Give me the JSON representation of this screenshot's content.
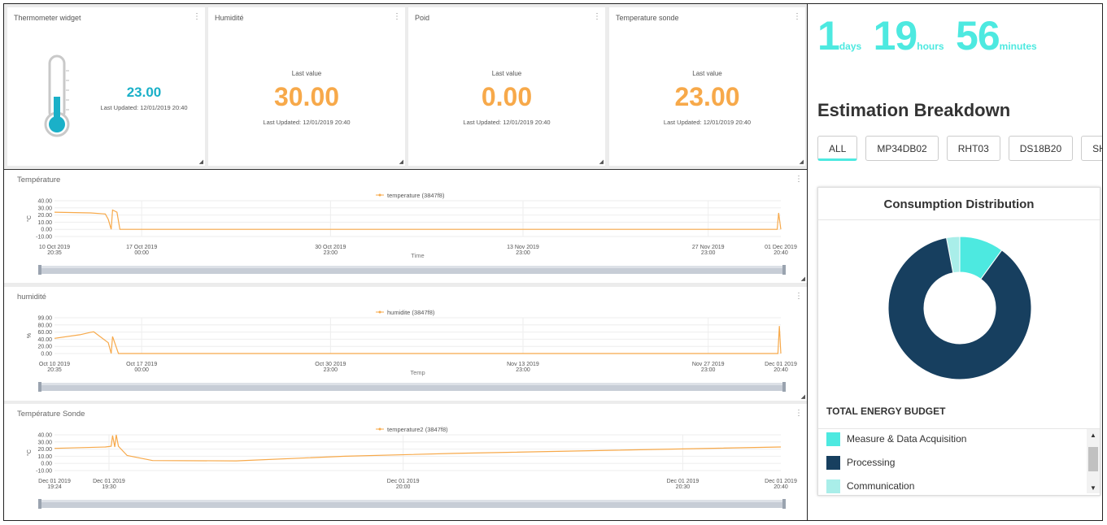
{
  "widgets": {
    "thermometer": {
      "title": "Thermometer widget",
      "value": "23.00",
      "updated": "Last Updated: 12/01/2019 20:40"
    },
    "humidity": {
      "title": "Humidité",
      "last_label": "Last value",
      "value": "30.00",
      "updated": "Last Updated: 12/01/2019 20:40"
    },
    "weight": {
      "title": "Poid",
      "last_label": "Last value",
      "value": "0.00",
      "updated": "Last Updated: 12/01/2019 20:40"
    },
    "probe": {
      "title": "Temperature sonde",
      "last_label": "Last value",
      "value": "23.00",
      "updated": "Last Updated: 12/01/2019 20:40"
    }
  },
  "charts": {
    "temperature": {
      "title": "Température",
      "legend": "temperature  (3847f8)",
      "xlabel": "Time",
      "ylabel": "°C"
    },
    "humidite": {
      "title": "humidité",
      "legend": "humidite  (3847f8)",
      "xlabel": "Temp",
      "ylabel": "%"
    },
    "sonde": {
      "title": "Température Sonde",
      "legend": "temperature2  (3847f8)",
      "xlabel": "",
      "ylabel": "°C"
    }
  },
  "chart_data": [
    {
      "type": "line",
      "title": "Température",
      "xlabel": "Time",
      "ylabel": "°C",
      "ylim": [
        -10,
        40
      ],
      "yticks": [
        "40.00",
        "30.00",
        "20.00",
        "10.00",
        "0.00",
        "-10.00"
      ],
      "xticks": [
        {
          "d": "10 Oct 2019",
          "t": "20:35"
        },
        {
          "d": "17 Oct 2019",
          "t": "00:00"
        },
        {
          "d": "30 Oct 2019",
          "t": "23:00"
        },
        {
          "d": "13 Nov 2019",
          "t": "23:00"
        },
        {
          "d": "27 Nov 2019",
          "t": "23:00"
        },
        {
          "d": "01 Dec 2019",
          "t": "20:40"
        }
      ],
      "series": [
        {
          "name": "temperature  (3847f8)",
          "x": [
            0,
            0.05,
            0.07,
            0.074,
            0.078,
            0.08,
            0.086,
            0.09,
            0.995,
            0.997,
            1
          ],
          "y": [
            24,
            23,
            21.5,
            14,
            0,
            27,
            24,
            0,
            0,
            23,
            0
          ]
        }
      ],
      "grid": true,
      "legend": "top"
    },
    {
      "type": "line",
      "title": "humidité",
      "xlabel": "Temp",
      "ylabel": "%",
      "ylim": [
        0,
        99
      ],
      "yticks": [
        "99.00",
        "80.00",
        "60.00",
        "40.00",
        "20.00",
        "0.00"
      ],
      "xticks": [
        {
          "d": "Oct 10 2019",
          "t": "20:35"
        },
        {
          "d": "Oct 17 2019",
          "t": "00:00"
        },
        {
          "d": "Oct 30 2019",
          "t": "23:00"
        },
        {
          "d": "Nov 13 2019",
          "t": "23:00"
        },
        {
          "d": "Nov 27 2019",
          "t": "23:00"
        },
        {
          "d": "Dec 01 2019",
          "t": "20:40"
        }
      ],
      "series": [
        {
          "name": "humidite  (3847f8)",
          "x": [
            0,
            0.035,
            0.05,
            0.054,
            0.074,
            0.078,
            0.08,
            0.088,
            0.996,
            0.998,
            1
          ],
          "y": [
            42,
            52,
            59,
            60,
            30,
            0,
            47,
            0,
            0,
            76,
            0
          ]
        }
      ],
      "grid": true,
      "legend": "top"
    },
    {
      "type": "line",
      "title": "Température Sonde",
      "xlabel": "",
      "ylabel": "°C",
      "ylim": [
        -10,
        40
      ],
      "yticks": [
        "40.00",
        "30.00",
        "20.00",
        "10.00",
        "0.00",
        "-10.00"
      ],
      "xticks": [
        {
          "d": "Dec 01 2019",
          "t": "19:24"
        },
        {
          "d": "Dec 01 2019",
          "t": "19:30"
        },
        {
          "d": "Dec 01 2019",
          "t": "20:00"
        },
        {
          "d": "Dec 01 2019",
          "t": "20:30"
        },
        {
          "d": "Dec 01 2019",
          "t": "20:40"
        }
      ],
      "series": [
        {
          "name": "temperature2  (3847f8)",
          "x": [
            0,
            0.07,
            0.078,
            0.08,
            0.083,
            0.085,
            0.088,
            0.1,
            0.135,
            0.25,
            0.4,
            0.55,
            0.75,
            1
          ],
          "y": [
            21,
            23,
            24,
            39,
            23,
            40,
            24,
            11,
            4,
            3.5,
            10,
            14,
            18,
            23
          ]
        }
      ],
      "grid": true,
      "legend": "top"
    },
    {
      "type": "pie",
      "title": "Consumption Distribution",
      "labels": [
        "Measure & Data Acquisition",
        "Processing",
        "Communication"
      ],
      "values": [
        10,
        87,
        3
      ],
      "colors": [
        "#4de9e0",
        "#173f5f",
        "#a9eee9"
      ]
    }
  ],
  "uptime": {
    "days": "1",
    "days_unit": "days",
    "hours": "19",
    "hours_unit": "hours",
    "minutes": "56",
    "minutes_unit": "minutes"
  },
  "estimation": {
    "title": "Estimation Breakdown",
    "tabs": [
      "ALL",
      "MP34DB02",
      "RHT03",
      "DS18B20",
      "SH"
    ],
    "panel_title": "Consumption Distribution",
    "budget_title": "TOTAL ENERGY BUDGET",
    "legend": [
      {
        "label": "Measure & Data Acquisition",
        "color": "#4de9e0"
      },
      {
        "label": "Processing",
        "color": "#173f5f"
      },
      {
        "label": "Communication",
        "color": "#a9eee9"
      }
    ]
  },
  "colors": {
    "accent": "#4de9e0",
    "orange": "#f7a94a",
    "thermo": "#1ab0c8",
    "navy": "#173f5f"
  }
}
